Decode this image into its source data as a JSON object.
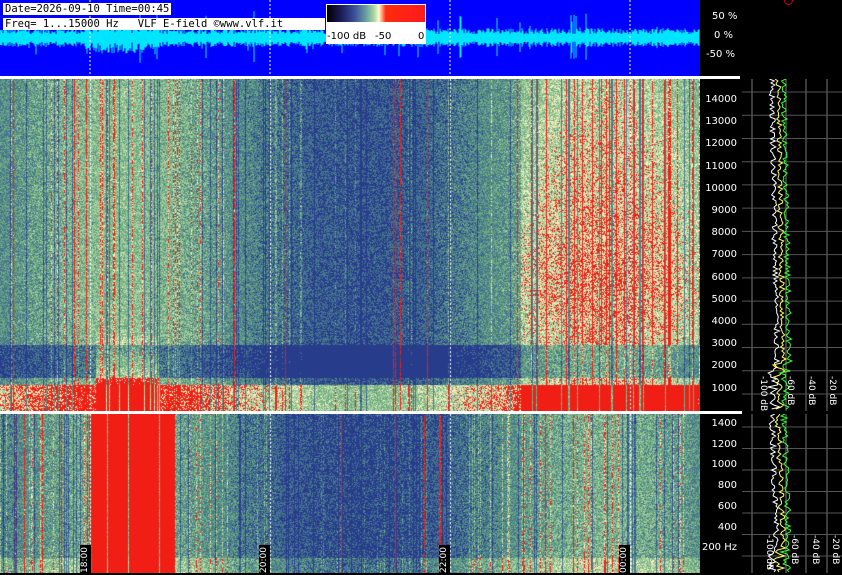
{
  "header": {
    "date_line": "Date=2026-09-10 Time=00:45",
    "freq_line": "Freq= 1...15000 Hz   VLF E-field ©www.vlf.it"
  },
  "colorbar": {
    "labels": [
      "-100 dB",
      "-50",
      "0"
    ]
  },
  "waveform_axis": [
    "50 %",
    "0 %",
    "-50 %"
  ],
  "upper_freq_ticks": [
    "14000",
    "13000",
    "12000",
    "11000",
    "10000",
    "9000",
    "8000",
    "7000",
    "6000",
    "5000",
    "4000",
    "3000",
    "2000",
    "1000"
  ],
  "lower_freq_ticks": [
    "1400",
    "1200",
    "1000",
    "800",
    "600",
    "400",
    "200 Hz"
  ],
  "time_labels": [
    "18:00",
    "20:00",
    "22:00",
    "00:00"
  ],
  "upper_db_labels": [
    "-100 dB",
    "-60 dB",
    "-40 dB",
    "-20 dB"
  ],
  "lower_db_labels": [
    "-100 dB",
    "-60 dB",
    "-40 dB",
    "-20 dB"
  ],
  "colors": {
    "waveform_bg": "#0000ff",
    "waveform_trace": "#00e5ff",
    "profile_avg": "#ffff66",
    "profile_peak": "#33ff33",
    "profile_min": "#ffffff"
  }
}
